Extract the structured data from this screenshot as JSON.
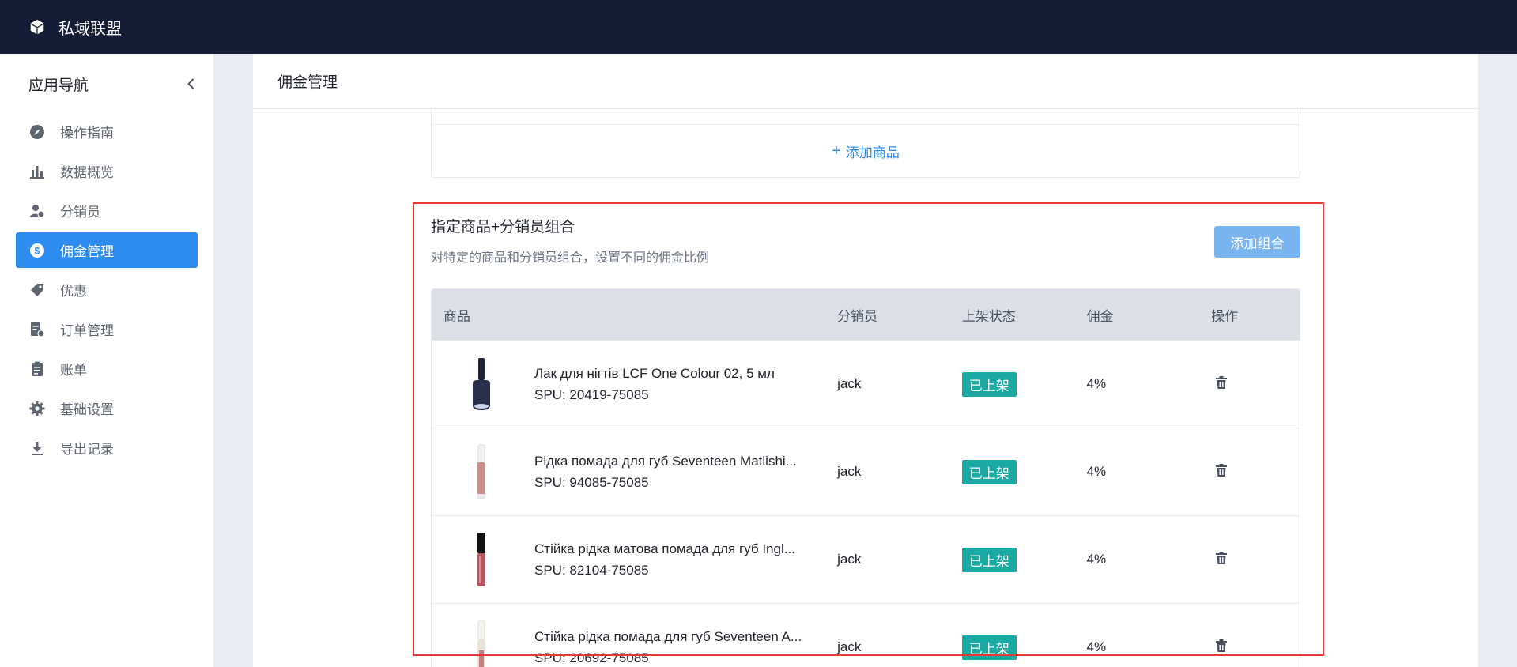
{
  "app": {
    "title": "私域联盟"
  },
  "sidebar": {
    "title": "应用导航",
    "items": [
      {
        "label": "操作指南",
        "icon": "compass-icon"
      },
      {
        "label": "数据概览",
        "icon": "bar-chart-icon"
      },
      {
        "label": "分销员",
        "icon": "distributor-icon"
      },
      {
        "label": "佣金管理",
        "icon": "dollar-circle-icon",
        "active": true
      },
      {
        "label": "优惠",
        "icon": "tag-icon"
      },
      {
        "label": "订单管理",
        "icon": "order-icon"
      },
      {
        "label": "账单",
        "icon": "clipboard-icon"
      },
      {
        "label": "基础设置",
        "icon": "gear-icon"
      },
      {
        "label": "导出记录",
        "icon": "download-icon"
      }
    ]
  },
  "page": {
    "title": "佣金管理"
  },
  "add_product": {
    "plus": "+",
    "label": "添加商品"
  },
  "combo": {
    "title": "指定商品+分销员组合",
    "description": "对特定的商品和分销员组合，设置不同的佣金比例",
    "add_button": "添加组合",
    "columns": {
      "product": "商品",
      "distributor": "分销员",
      "status": "上架状态",
      "commission": "佣金",
      "operation": "操作"
    },
    "rows": [
      {
        "name": "Лак для нігтів LCF One Colour 02, 5 мл",
        "spu": "SPU: 20419-75085",
        "distributor": "jack",
        "status": "已上架",
        "commission": "4%",
        "thumb": "nail-polish"
      },
      {
        "name": "Рідка помада для губ Seventeen Matlishi...",
        "spu": "SPU: 94085-75085",
        "distributor": "jack",
        "status": "已上架",
        "commission": "4%",
        "thumb": "lip-gloss-light"
      },
      {
        "name": "Стійка рідка матова помада для губ Ingl...",
        "spu": "SPU: 82104-75085",
        "distributor": "jack",
        "status": "已上架",
        "commission": "4%",
        "thumb": "lip-gloss-dark"
      },
      {
        "name": "Стійка рідка помада для губ Seventeen A...",
        "spu": "SPU: 20692-75085",
        "distributor": "jack",
        "status": "已上架",
        "commission": "4%",
        "thumb": "lip-gloss-clear"
      }
    ]
  },
  "colors": {
    "topbar": "#151d36",
    "accent": "#2e8cf0",
    "status": "#1ba9a3",
    "highlight": "#e53935"
  }
}
